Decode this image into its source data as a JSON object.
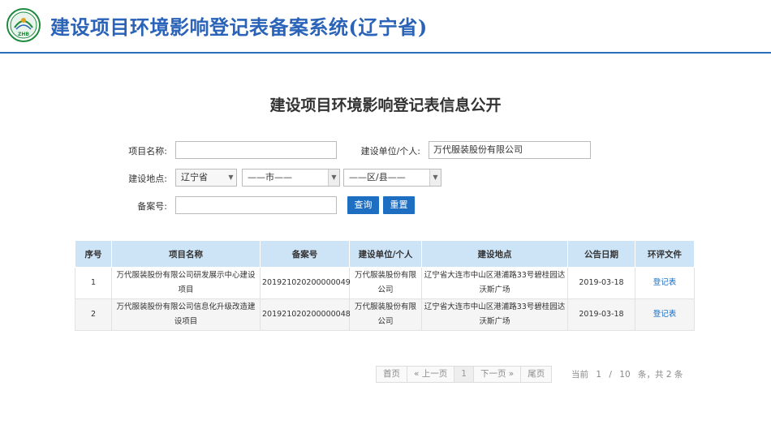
{
  "header": {
    "title": "建设项目环境影响登记表备案系统(辽宁省)",
    "logo_text": "ZHB"
  },
  "page_title": "建设项目环境影响登记表信息公开",
  "form": {
    "project_name_label": "项目名称:",
    "project_name_value": "",
    "unit_label": "建设单位/个人:",
    "unit_value": "万代服装股份有限公司",
    "location_label": "建设地点:",
    "province_value": "辽宁省",
    "city_value": "——市——",
    "district_value": "——区/县——",
    "record_no_label": "备案号:",
    "record_no_value": "",
    "query_button": "查询",
    "reset_button": "重置"
  },
  "table": {
    "headers": [
      "序号",
      "项目名称",
      "备案号",
      "建设单位/个人",
      "建设地点",
      "公告日期",
      "环评文件"
    ],
    "rows": [
      {
        "no": "1",
        "name": "万代服装股份有限公司研发展示中心建设项目",
        "record": "201921020200000049",
        "unit": "万代服装股份有限公司",
        "location": "辽宁省大连市中山区港浦路33号碧桂园达沃斯广场",
        "date": "2019-03-18",
        "doc": "登记表"
      },
      {
        "no": "2",
        "name": "万代服装股份有限公司信息化升级改造建设项目",
        "record": "201921020200000048",
        "unit": "万代服装股份有限公司",
        "location": "辽宁省大连市中山区港浦路33号碧桂园达沃斯广场",
        "date": "2019-03-18",
        "doc": "登记表"
      }
    ]
  },
  "pagination": {
    "first": "首页",
    "prev": "« 上一页",
    "current": "1",
    "next": "下一页 »",
    "last": "尾页",
    "info_current_label": "当前",
    "info_current": "1",
    "info_sep": "/",
    "info_page_size": "10",
    "info_total": "条，共 2 条"
  }
}
